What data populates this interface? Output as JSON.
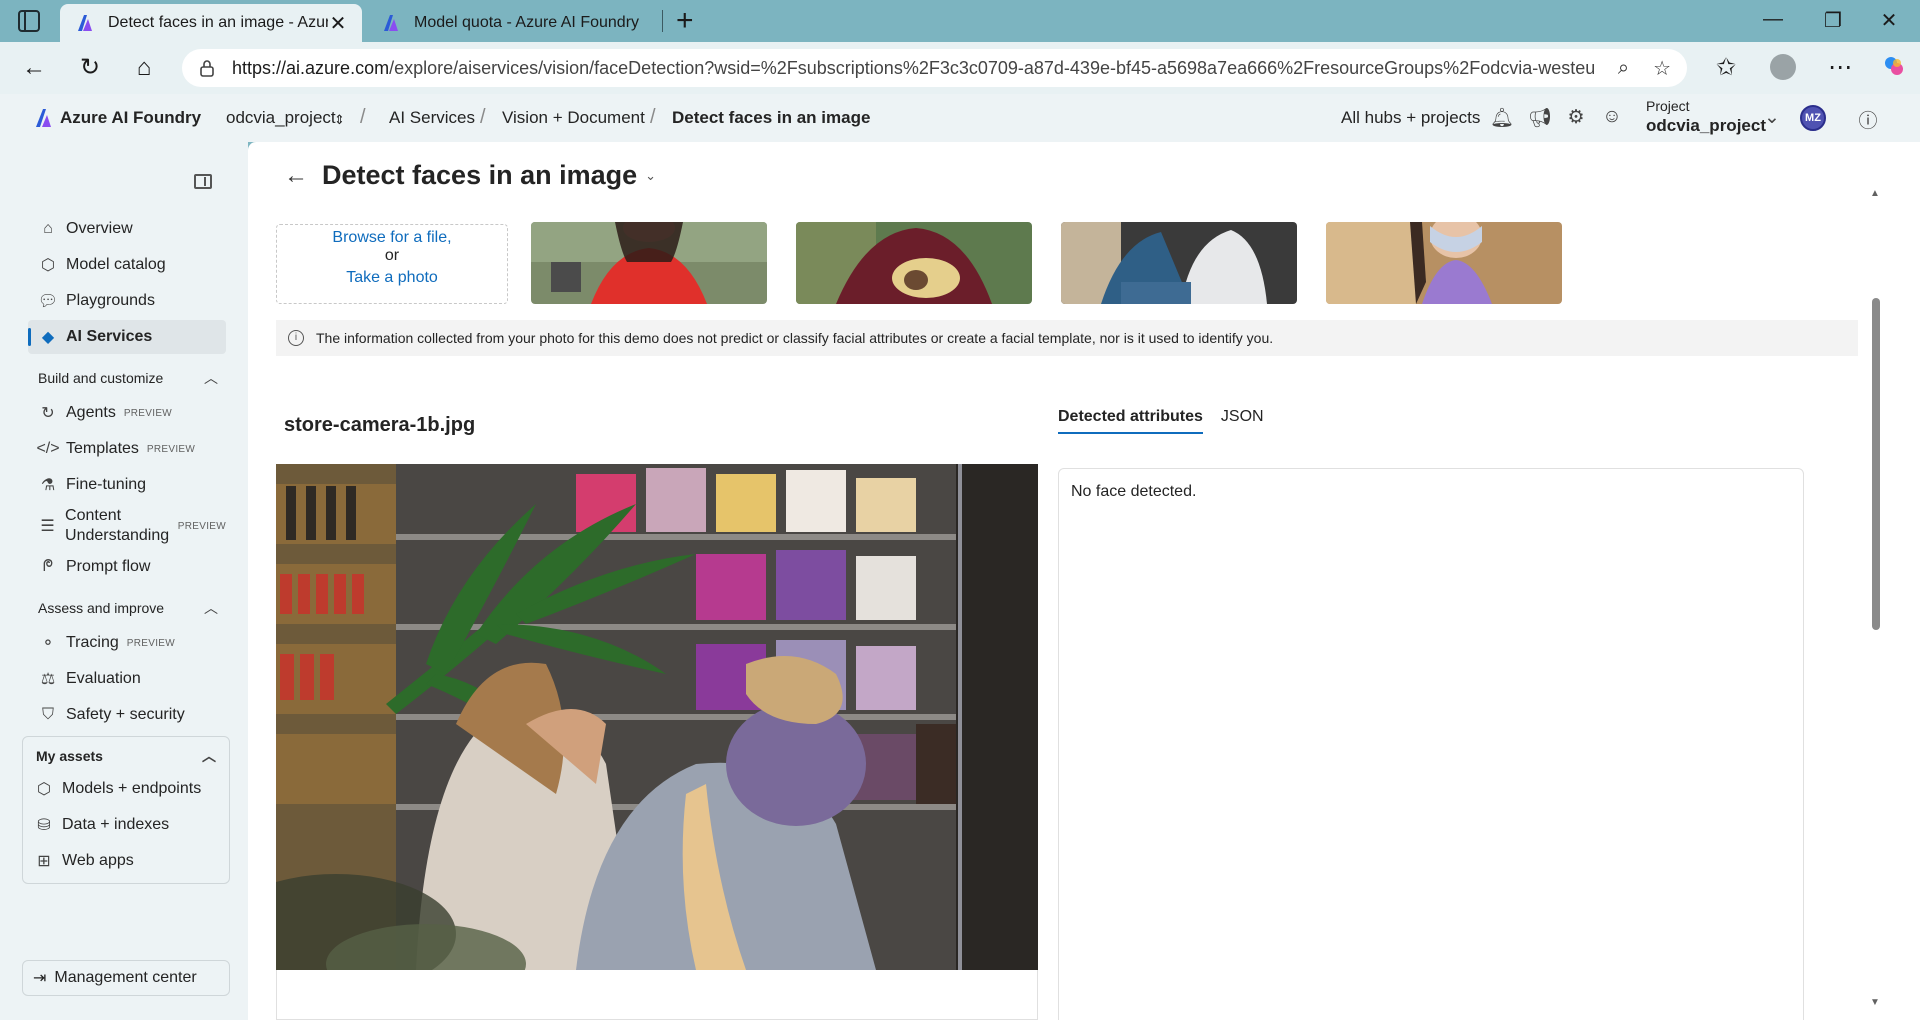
{
  "browser": {
    "tabs": [
      {
        "title": "Detect faces in an image - Azure AI Foundry",
        "close": "✕"
      },
      {
        "title": "Model quota - Azure AI Foundry"
      }
    ],
    "new_tab": "+",
    "window": {
      "minimize": "—",
      "maximize": "❐",
      "close": "✕"
    },
    "url_host": "https://ai.azure.com",
    "url_path": "/explore/aiservices/vision/faceDetection?wsid=%2Fsubscriptions%2F3c3c0709-a87d-439e-bf45-a5698a7ea666%2FresourceGroups%2Fodcvia-westeu-r..."
  },
  "header": {
    "brand": "Azure AI Foundry",
    "breadcrumb": [
      "odcvia_project",
      "AI Services",
      "Vision + Document",
      "Detect faces in an image"
    ],
    "all_hubs": "All hubs + projects",
    "project_label": "Project",
    "project_name": "odcvia_project",
    "user_initials": "MZ"
  },
  "sidebar": {
    "items": [
      {
        "label": "Overview",
        "icon": "home-icon"
      },
      {
        "label": "Model catalog",
        "icon": "cube-icon"
      },
      {
        "label": "Playgrounds",
        "icon": "chat-icon"
      },
      {
        "label": "AI Services",
        "icon": "ai-services-icon"
      }
    ],
    "build_section": "Build and customize",
    "build_items": [
      {
        "label": "Agents",
        "badge": "PREVIEW"
      },
      {
        "label": "Templates",
        "badge": "PREVIEW"
      },
      {
        "label": "Fine-tuning"
      },
      {
        "label": "Content Understanding",
        "badge": "PREVIEW"
      },
      {
        "label": "Prompt flow"
      }
    ],
    "assess_section": "Assess and improve",
    "assess_items": [
      {
        "label": "Tracing",
        "badge": "PREVIEW"
      },
      {
        "label": "Evaluation"
      },
      {
        "label": "Safety + security"
      }
    ],
    "assets_section": "My assets",
    "assets_items": [
      {
        "label": "Models + endpoints"
      },
      {
        "label": "Data + indexes"
      },
      {
        "label": "Web apps"
      }
    ],
    "management": "Management center"
  },
  "main": {
    "title": "Detect faces in an image",
    "upload": {
      "browse": "Browse for a file,",
      "or": "or",
      "take_photo": "Take a photo"
    },
    "info": "The information collected from your photo for this demo does not predict or classify facial attributes or create a facial template, nor is it used to identify you.",
    "file_name": "store-camera-1b.jpg",
    "tabs": [
      "Detected attributes",
      "JSON"
    ],
    "result": "No face detected."
  },
  "colors": {
    "accent": "#0f6cbd",
    "tab_strip": "#7cb4c0",
    "sidebar_bg": "#edf3f5"
  }
}
